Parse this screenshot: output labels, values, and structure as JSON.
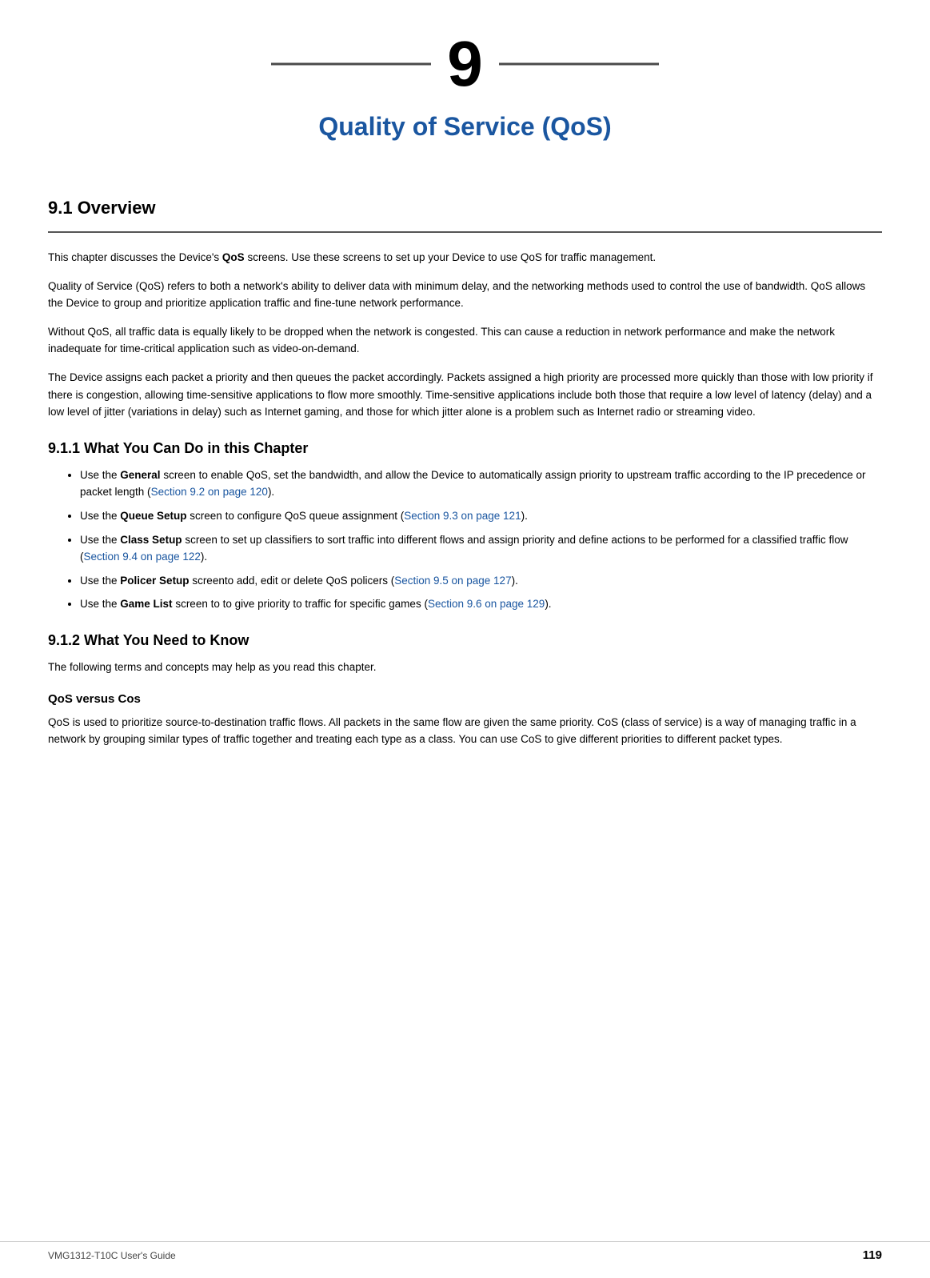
{
  "chapter": {
    "number": "9",
    "title": "Quality of Service (QoS)",
    "line_decoration": true
  },
  "section_9_1": {
    "heading": "9.1  Overview",
    "paragraphs": [
      "This chapter discusses the Device's QoS screens. Use these screens to set up your Device to use QoS for traffic management.",
      "Quality of Service (QoS) refers to both a network's ability to deliver data with minimum delay, and the networking methods used to control the use of bandwidth. QoS allows the Device to group and prioritize application traffic and fine-tune network performance.",
      "Without QoS, all traffic data is equally likely to be dropped when the network is congested. This can cause a reduction in network performance and make the network inadequate for time-critical application such as video-on-demand.",
      "The Device assigns each packet a priority and then queues the packet accordingly. Packets assigned a high priority are processed more quickly than those with low priority if there is congestion, allowing time-sensitive applications to flow more smoothly. Time-sensitive applications include both those that require a low level of latency (delay) and a low level of jitter (variations in delay) such as Internet gaming, and those for which jitter alone is a problem such as Internet radio or streaming video."
    ],
    "para1_bold": "QoS"
  },
  "section_9_1_1": {
    "heading": "9.1.1  What You Can Do in this Chapter",
    "bullets": [
      {
        "text_before": "Use the ",
        "bold": "General",
        "text_after": " screen to enable QoS, set the bandwidth, and allow the Device to automatically assign priority to upstream traffic according to the IP precedence or packet length (",
        "link": "Section 9.2 on page 120",
        "text_end": ")."
      },
      {
        "text_before": "Use the ",
        "bold": "Queue Setup",
        "text_after": " screen to configure QoS queue assignment (",
        "link": "Section 9.3 on page 121",
        "text_end": ")."
      },
      {
        "text_before": "Use the ",
        "bold": "Class Setup",
        "text_after": " screen to set up classifiers to sort traffic into different flows and assign priority and define actions to be performed for a classified traffic flow (",
        "link": "Section 9.4 on page 122",
        "text_end": ")."
      },
      {
        "text_before": "Use the ",
        "bold": "Policer Setup",
        "text_after": " screento add, edit or delete QoS policers (",
        "link": "Section 9.5 on page 127",
        "text_end": ")."
      },
      {
        "text_before": "Use the ",
        "bold": "Game List",
        "text_after": " screen to to give priority to traffic for specific games (",
        "link": "Section 9.6 on page 129",
        "text_end": ")."
      }
    ]
  },
  "section_9_1_2": {
    "heading": "9.1.2  What You Need to Know",
    "intro": "The following terms and concepts may help as you read this chapter.",
    "subsections": [
      {
        "heading": "QoS versus Cos",
        "text": "QoS is used to prioritize source-to-destination traffic flows. All packets in the same flow are given the same priority. CoS (class of service) is a way of managing traffic in a network by grouping similar types of traffic together and treating each type as a class. You can use CoS to give different priorities to different packet types."
      }
    ]
  },
  "footer": {
    "left": "VMG1312-T10C User's Guide",
    "right": "119"
  }
}
